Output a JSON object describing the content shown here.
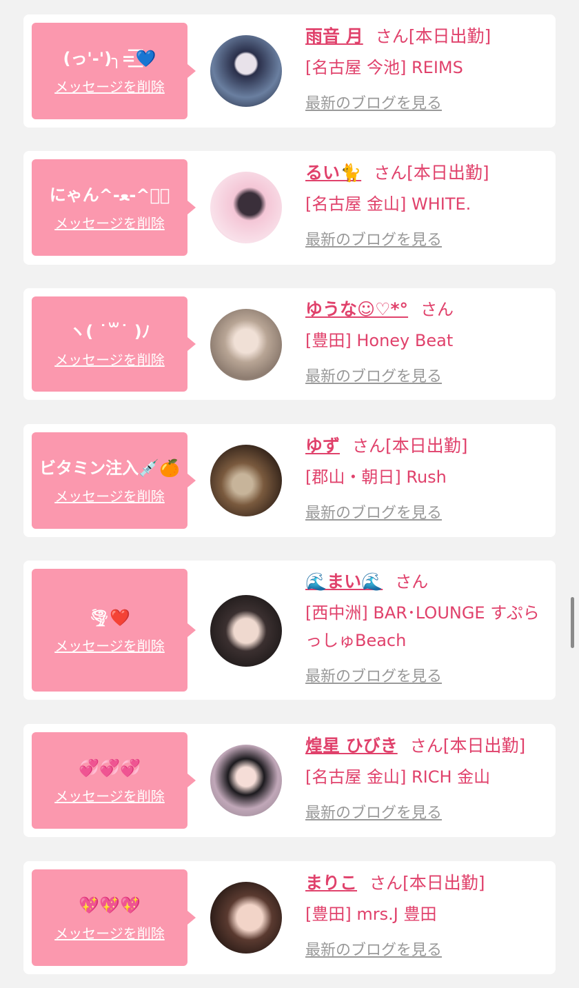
{
  "cards": [
    {
      "message": "(っ'-')╮=͟͟͞͞💙",
      "delete_label": "メッセージを削除",
      "name": "雨音 月",
      "san": "さん",
      "status": "[本日出勤]",
      "shop": "[名古屋 今池] REIMS",
      "blog_label": "最新のブログを見る"
    },
    {
      "message": "にゃん^-ﻌ-^ฅ゙",
      "delete_label": "メッセージを削除",
      "name": "るい🐈",
      "san": "さん",
      "status": "[本日出勤]",
      "shop": "[名古屋 金山] WHITE.",
      "blog_label": "最新のブログを見る"
    },
    {
      "message": "ヽ( ˙꒳˙ )ﾉ",
      "delete_label": "メッセージを削除",
      "name": "ゆうな☺︎♡*°",
      "san": "さん",
      "status": "",
      "shop": "[豊田] Honey Beat",
      "blog_label": "最新のブログを見る"
    },
    {
      "message": "ビタミン注入💉🍊",
      "delete_label": "メッセージを削除",
      "name": "ゆず",
      "san": "さん",
      "status": "[本日出勤]",
      "shop": "[郡山・朝日] Rush",
      "blog_label": "最新のブログを見る"
    },
    {
      "message": "🌪❤️",
      "delete_label": "メッセージを削除",
      "name": "🌊まい🌊",
      "san": "さん",
      "status": "",
      "shop": "[西中洲] BAR･LOUNGE すぷらっしゅBeach",
      "blog_label": "最新のブログを見る"
    },
    {
      "message": "💞💞💞",
      "delete_label": "メッセージを削除",
      "name": "煌星 ひびき",
      "san": "さん",
      "status": "[本日出勤]",
      "shop": "[名古屋 金山] RICH 金山",
      "blog_label": "最新のブログを見る"
    },
    {
      "message": "💖💖💖",
      "delete_label": "メッセージを削除",
      "name": "まりこ",
      "san": "さん",
      "status": "[本日出勤]",
      "shop": "[豊田] mrs.J 豊田",
      "blog_label": "最新のブログを見る"
    }
  ],
  "colors": {
    "page_bg": "#f2f2f2",
    "card_bg": "#ffffff",
    "bubble_bg": "#fb98ae",
    "accent": "#e0416b",
    "link_gray": "#999999"
  }
}
